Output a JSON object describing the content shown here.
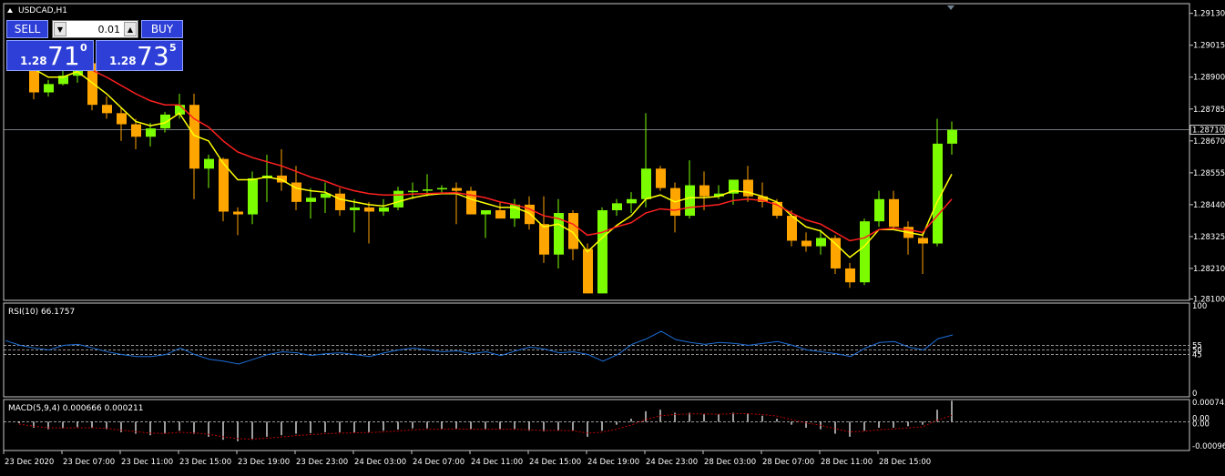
{
  "main_title": "USDCAD,H1",
  "trade_panel": {
    "sell_label": "SELL",
    "buy_label": "BUY",
    "lot_value": "0.01",
    "bid_prefix": "1.28",
    "bid_big": "71",
    "bid_sup": "0",
    "ask_prefix": "1.28",
    "ask_big": "73",
    "ask_sup": "5"
  },
  "rsi_label": "RSI(10) 66.1757",
  "macd_label": "MACD(5,9,4) 0.000666 0.000211",
  "colors": {
    "bull": "#7cfc00",
    "bear": "#ffa500",
    "ma_fast": "#ffff00",
    "ma_slow": "#ff2020",
    "rsi_line": "#1e6fd9",
    "macd_signal": "#c00000",
    "panel_border": "#c8c8c8",
    "axis_text": "#ffffff",
    "trade_button": "#2d3fd6"
  },
  "chart_data": [
    {
      "type": "candlestick",
      "title": "USDCAD,H1",
      "y_ticks": [
        "1.29130",
        "1.29015",
        "1.28900",
        "1.28785",
        "1.28670",
        "1.28555",
        "1.28440",
        "1.28325",
        "1.28210",
        "1.28100"
      ],
      "ylim": [
        1.28095,
        1.29165
      ],
      "current_price": "1.28710",
      "x_tick_labels": [
        "23 Dec 2020",
        "23 Dec 07:00",
        "23 Dec 11:00",
        "23 Dec 15:00",
        "23 Dec 19:00",
        "23 Dec 23:00",
        "24 Dec 03:00",
        "24 Dec 07:00",
        "24 Dec 11:00",
        "24 Dec 15:00",
        "24 Dec 19:00",
        "24 Dec 23:00",
        "28 Dec 03:00",
        "28 Dec 07:00",
        "28 Dec 11:00",
        "28 Dec 15:00"
      ],
      "candles": [
        [
          1.28966,
          1.28985,
          1.2893,
          1.28945
        ],
        [
          1.28945,
          1.2896,
          1.2882,
          1.28845
        ],
        [
          1.28845,
          1.2889,
          1.2883,
          1.28875
        ],
        [
          1.28875,
          1.28925,
          1.2887,
          1.28905
        ],
        [
          1.28905,
          1.29,
          1.2888,
          1.2895
        ],
        [
          1.2895,
          1.2898,
          1.2878,
          1.288
        ],
        [
          1.288,
          1.2883,
          1.2875,
          1.2877
        ],
        [
          1.2877,
          1.2879,
          1.2867,
          1.2873
        ],
        [
          1.2873,
          1.2875,
          1.2864,
          1.28685
        ],
        [
          1.28685,
          1.28735,
          1.2865,
          1.28715
        ],
        [
          1.28715,
          1.28775,
          1.287,
          1.28765
        ],
        [
          1.28765,
          1.2884,
          1.2875,
          1.288
        ],
        [
          1.288,
          1.2884,
          1.2846,
          1.2857
        ],
        [
          1.2857,
          1.2862,
          1.285,
          1.28605
        ],
        [
          1.28605,
          1.2861,
          1.2838,
          1.28415
        ],
        [
          1.28415,
          1.2843,
          1.2833,
          1.28405
        ],
        [
          1.28405,
          1.2856,
          1.2837,
          1.28535
        ],
        [
          1.28535,
          1.2862,
          1.2845,
          1.28545
        ],
        [
          1.28545,
          1.2864,
          1.2849,
          1.2852
        ],
        [
          1.2852,
          1.2858,
          1.2842,
          1.2845
        ],
        [
          1.2845,
          1.285,
          1.2839,
          1.28465
        ],
        [
          1.28465,
          1.2852,
          1.2841,
          1.2848
        ],
        [
          1.2848,
          1.285,
          1.284,
          1.2842
        ],
        [
          1.2842,
          1.2846,
          1.2834,
          1.2843
        ],
        [
          1.2843,
          1.2845,
          1.283,
          1.28415
        ],
        [
          1.28415,
          1.2846,
          1.284,
          1.2843
        ],
        [
          1.2843,
          1.28505,
          1.2842,
          1.2849
        ],
        [
          1.2849,
          1.2852,
          1.2846,
          1.2849
        ],
        [
          1.2849,
          1.2855,
          1.2847,
          1.28495
        ],
        [
          1.28495,
          1.2851,
          1.2848,
          1.285
        ],
        [
          1.285,
          1.2852,
          1.2837,
          1.2849
        ],
        [
          1.2849,
          1.28505,
          1.2841,
          1.28405
        ],
        [
          1.28405,
          1.2842,
          1.2832,
          1.2842
        ],
        [
          1.2842,
          1.2845,
          1.284,
          1.2839
        ],
        [
          1.2839,
          1.2846,
          1.2836,
          1.2844
        ],
        [
          1.2844,
          1.2847,
          1.2835,
          1.2837
        ],
        [
          1.2837,
          1.2847,
          1.2823,
          1.2826
        ],
        [
          1.2826,
          1.2846,
          1.2821,
          1.2841
        ],
        [
          1.2841,
          1.2842,
          1.2824,
          1.2828
        ],
        [
          1.2828,
          1.283,
          1.2812,
          1.2812
        ],
        [
          1.2812,
          1.2843,
          1.2812,
          1.2842
        ],
        [
          1.2842,
          1.2846,
          1.284,
          1.28445
        ],
        [
          1.28445,
          1.28485,
          1.2841,
          1.2846
        ],
        [
          1.2846,
          1.2877,
          1.2843,
          1.2857
        ],
        [
          1.2857,
          1.2858,
          1.2849,
          1.285
        ],
        [
          1.285,
          1.2852,
          1.2834,
          1.284
        ],
        [
          1.284,
          1.286,
          1.2839,
          1.2851
        ],
        [
          1.2851,
          1.2856,
          1.2842,
          1.2847
        ],
        [
          1.2847,
          1.2851,
          1.2846,
          1.2848
        ],
        [
          1.2848,
          1.2851,
          1.2844,
          1.2853
        ],
        [
          1.2853,
          1.2858,
          1.2845,
          1.2847
        ],
        [
          1.2847,
          1.2852,
          1.2843,
          1.2845
        ],
        [
          1.2845,
          1.2846,
          1.2839,
          1.284
        ],
        [
          1.284,
          1.2842,
          1.2829,
          1.2831
        ],
        [
          1.2831,
          1.2834,
          1.2827,
          1.2829
        ],
        [
          1.2829,
          1.2835,
          1.2826,
          1.2832
        ],
        [
          1.2832,
          1.2833,
          1.2819,
          1.2821
        ],
        [
          1.2821,
          1.2823,
          1.2814,
          1.2816
        ],
        [
          1.2816,
          1.2839,
          1.2815,
          1.2838
        ],
        [
          1.2838,
          1.2849,
          1.2836,
          1.2846
        ],
        [
          1.2846,
          1.2849,
          1.2835,
          1.2836
        ],
        [
          1.2836,
          1.2838,
          1.2826,
          1.2832
        ],
        [
          1.2832,
          1.2834,
          1.2819,
          1.283
        ],
        [
          1.283,
          1.2875,
          1.2829,
          1.2866
        ],
        [
          1.2866,
          1.2874,
          1.2862,
          1.2871
        ]
      ],
      "series": [
        {
          "values": [
            1.2896,
            1.2893,
            1.289,
            1.289,
            1.2892,
            1.2888,
            1.2884,
            1.2879,
            1.2874,
            1.28725,
            1.28735,
            1.2877,
            1.2869,
            1.2867,
            1.2859,
            1.2853,
            1.2853,
            1.2854,
            1.2853,
            1.285,
            1.2849,
            1.28485,
            1.2846,
            1.2845,
            1.2844,
            1.28435,
            1.2845,
            1.28465,
            1.28475,
            1.2848,
            1.2848,
            1.2846,
            1.28445,
            1.2843,
            1.2843,
            1.2841,
            1.2836,
            1.2837,
            1.2834,
            1.2827,
            1.2832,
            1.28365,
            1.284,
            1.2846,
            1.28475,
            1.2845,
            1.28465,
            1.28465,
            1.2847,
            1.2849,
            1.28485,
            1.2847,
            1.2845,
            1.284,
            1.2836,
            1.28345,
            1.283,
            1.2825,
            1.2829,
            1.2835,
            1.2835,
            1.2834,
            1.2833,
            1.2845,
            1.2855
          ]
        },
        {
          "values": [
            1.2899,
            1.2898,
            1.28965,
            1.2895,
            1.28945,
            1.28925,
            1.289,
            1.2887,
            1.2884,
            1.28815,
            1.288,
            1.288,
            1.2875,
            1.2872,
            1.2867,
            1.2863,
            1.2861,
            1.28595,
            1.2858,
            1.2856,
            1.2854,
            1.28525,
            1.28505,
            1.2849,
            1.2848,
            1.28475,
            1.28475,
            1.28478,
            1.2848,
            1.28482,
            1.28483,
            1.28475,
            1.28465,
            1.2845,
            1.2844,
            1.28425,
            1.284,
            1.2839,
            1.2837,
            1.2833,
            1.2834,
            1.2836,
            1.28375,
            1.2841,
            1.28425,
            1.2842,
            1.2843,
            1.28435,
            1.2844,
            1.28455,
            1.2846,
            1.28455,
            1.2844,
            1.2841,
            1.28385,
            1.2837,
            1.2834,
            1.2831,
            1.2832,
            1.2835,
            1.28355,
            1.2835,
            1.2834,
            1.284,
            1.2846
          ]
        }
      ]
    },
    {
      "type": "line",
      "title": "RSI(10) 66.1757",
      "ylim": [
        0,
        100
      ],
      "y_ticks": [
        "100",
        "55",
        "50",
        "45",
        "0"
      ],
      "levels": [
        55,
        50,
        45
      ],
      "values": [
        60,
        55,
        52,
        50,
        55,
        56,
        52,
        48,
        45,
        43,
        43,
        45,
        52,
        45,
        40,
        38,
        35,
        40,
        45,
        48,
        47,
        44,
        46,
        47,
        45,
        43,
        47,
        50,
        52,
        50,
        48,
        49,
        46,
        48,
        44,
        49,
        53,
        51,
        47,
        48,
        45,
        38,
        45,
        56,
        62,
        70,
        61,
        58,
        56,
        58,
        57,
        55,
        57,
        59,
        55,
        50,
        48,
        46,
        43,
        52,
        58,
        59,
        53,
        50,
        62,
        66
      ]
    },
    {
      "type": "bar",
      "title": "MACD(5,9,4) 0.000666 0.000211",
      "ylim": [
        -0.00096,
        0.00074
      ],
      "y_ticks": [
        "0.000743",
        "0.00",
        "0.00",
        "-0.000960"
      ],
      "values": [
        -5e-05,
        -0.0002,
        -0.00025,
        -0.00022,
        -0.00018,
        -0.0002,
        -0.00025,
        -0.00035,
        -0.0004,
        -0.00045,
        -0.0004,
        -0.0003,
        -0.0004,
        -0.0005,
        -0.0006,
        -0.00065,
        -0.0006,
        -0.0005,
        -0.00045,
        -0.0004,
        -0.00038,
        -0.00035,
        -0.00035,
        -0.00036,
        -0.00035,
        -0.0003,
        -0.00026,
        -0.00022,
        -0.00022,
        -0.00024,
        -0.00024,
        -0.00025,
        -0.00026,
        -0.00025,
        -0.00025,
        -0.0003,
        -0.00032,
        -0.0003,
        -0.0003,
        -0.0005,
        -0.0003,
        -0.0001,
        0.0001,
        0.00035,
        0.0004,
        0.0003,
        0.0003,
        0.00025,
        0.00025,
        0.0003,
        0.00028,
        0.0002,
        0.0001,
        -0.0001,
        -0.0002,
        -0.00025,
        -0.0004,
        -0.0005,
        -0.0003,
        -0.0002,
        -0.0002,
        -0.00015,
        -0.0001,
        0.0004,
        0.0007
      ],
      "signal": [
        -8e-05,
        -0.00015,
        -0.0002,
        -0.00021,
        -0.0002,
        -0.0002,
        -0.00022,
        -0.00028,
        -0.00033,
        -0.00038,
        -0.00039,
        -0.00035,
        -0.00037,
        -0.00042,
        -0.0005,
        -0.00056,
        -0.00058,
        -0.00055,
        -0.00051,
        -0.00046,
        -0.00043,
        -0.0004,
        -0.00038,
        -0.00037,
        -0.00036,
        -0.00034,
        -0.00031,
        -0.00027,
        -0.00025,
        -0.00025,
        -0.00024,
        -0.00025,
        -0.00025,
        -0.00025,
        -0.00025,
        -0.00027,
        -0.00029,
        -0.00029,
        -0.0003,
        -0.00038,
        -0.00035,
        -0.00025,
        -0.00011,
        7e-05,
        0.0002,
        0.00024,
        0.00026,
        0.00026,
        0.00025,
        0.00027,
        0.00027,
        0.00024,
        0.00019,
        7e-05,
        -4e-05,
        -0.00012,
        -0.00023,
        -0.00034,
        -0.00032,
        -0.00027,
        -0.00024,
        -0.00021,
        -0.00017,
        5e-05,
        0.00021
      ]
    }
  ]
}
